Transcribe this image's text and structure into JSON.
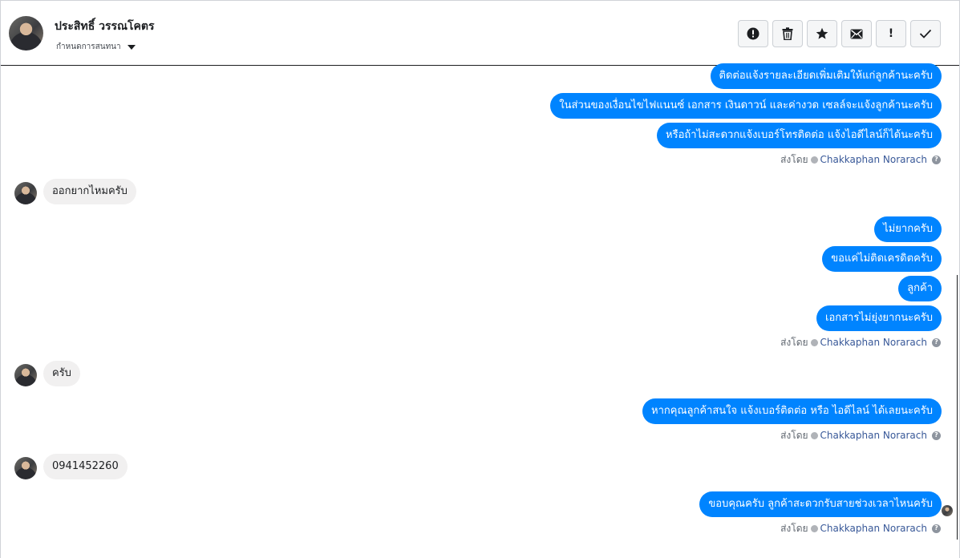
{
  "header": {
    "contact_name": "ประสิทธิ์ วรรณโคตร",
    "assign_label": "กำหนดการสนทนา"
  },
  "toolbar": {
    "spam_icon": "alert-circle-icon",
    "delete_icon": "trash-icon",
    "star_icon": "star-icon",
    "unread_icon": "envelope-icon",
    "follow_up_label": "!",
    "done_icon": "check-icon"
  },
  "messages": {
    "g1": [
      "ติดต่อแจ้งรายละเอียดเพิ่มเติมให้แก่ลูกค้านะครับ",
      "ในส่วนของเงื่อนไขไฟแนนซ์ เอกสาร เงินดาวน์ และค่างวด เซลล์จะแจ้งลูกค้านะครับ",
      "หรือถ้าไม่สะดวกแจ้งเบอร์โทรติดต่อ แจ้งไอดีไลน์ก็ได้นะครับ"
    ],
    "in1": "ออกยากไหมครับ",
    "g2": [
      "ไม่ยากครับ",
      "ขอแค่ไม่ติดเครดิตครับ",
      "ลูกค้า",
      "เอกสารไม่ยุ่งยากนะครับ"
    ],
    "in2": "ครับ",
    "g3": [
      "หากคุณลูกค้าสนใจ แจ้งเบอร์ติดต่อ หรือ ไอดีไลน์ ได้เลยนะครับ"
    ],
    "in3": "0941452260",
    "g4": [
      "ขอบคุณครับ ลูกค้าสะดวกรับสายช่วงเวลาไหนครับ"
    ]
  },
  "sent_by": {
    "prefix": "ส่งโดย",
    "agent": "Chakkaphan Norarach",
    "help": "?"
  },
  "colors": {
    "outgoing_bubble": "#0084ff",
    "incoming_bubble": "#f1f0f0",
    "agent_link": "#385898"
  }
}
